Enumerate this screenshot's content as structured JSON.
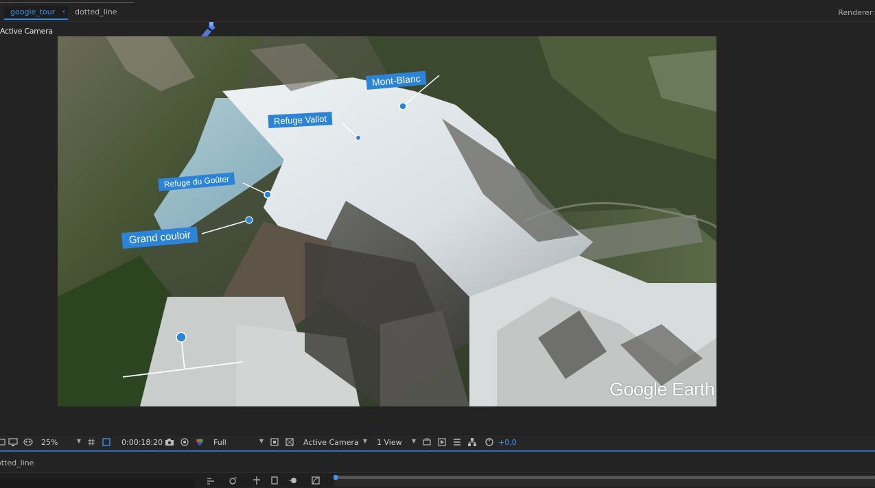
{
  "tabs": {
    "active": "google_tour",
    "second": "dotted_line",
    "renderer": "Renderer:"
  },
  "viewer": {
    "camera_label": "Active Camera",
    "logo": "Google Earth",
    "labels": {
      "mont_blanc": "Mont-Blanc",
      "refuge_vallot": "Refuge Vallot",
      "refuge_gouter": "Refuge du Goûter",
      "grand_couloir": "Grand couloir"
    }
  },
  "toolbar": {
    "zoom": "25%",
    "timecode": "0:00:18:20",
    "resolution": "Full",
    "camera": "Active Camera",
    "views": "1 View",
    "exposure": "+0,0"
  },
  "timeline": {
    "comp_name": "dotted_line"
  },
  "colors": {
    "accent": "#2d8ceb",
    "label_bg": "#2c84d8",
    "panel_bg": "#232323"
  }
}
